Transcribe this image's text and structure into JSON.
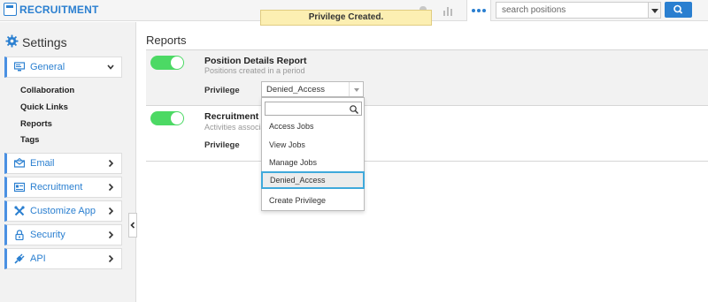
{
  "app": {
    "title": "RECRUITMENT"
  },
  "toast": {
    "message": "Privilege Created."
  },
  "search": {
    "placeholder": "search positions"
  },
  "sidebar": {
    "title": "Settings",
    "items": [
      {
        "label": "General",
        "icon": "monitor-icon"
      },
      {
        "label": "Email",
        "icon": "envelope-icon"
      },
      {
        "label": "Recruitment",
        "icon": "recruitment-icon"
      },
      {
        "label": "Customize App",
        "icon": "wrench-icon"
      },
      {
        "label": "Security",
        "icon": "lock-icon"
      },
      {
        "label": "API",
        "icon": "plug-icon"
      }
    ],
    "sub_items": [
      "Collaboration",
      "Quick Links",
      "Reports",
      "Tags"
    ]
  },
  "main": {
    "title": "Reports",
    "reports": [
      {
        "title": "Position Details Report",
        "subtitle": "Positions created in a period",
        "privilege_label": "Privilege",
        "privilege_value": "Denied_Access",
        "enabled": true
      },
      {
        "title": "Recruitment Ac",
        "subtitle": "Activities associat",
        "privilege_label": "Privilege",
        "enabled": true
      }
    ]
  },
  "dropdown": {
    "options": [
      "Access Jobs",
      "View Jobs",
      "Manage Jobs",
      "Denied_Access",
      "Create Privilege"
    ],
    "highlighted": "Denied_Access"
  },
  "colors": {
    "accent": "#2a7fd0",
    "toggle_on": "#4cd964",
    "toast_bg": "#fcefb2",
    "highlight_border": "#3fa9db"
  }
}
